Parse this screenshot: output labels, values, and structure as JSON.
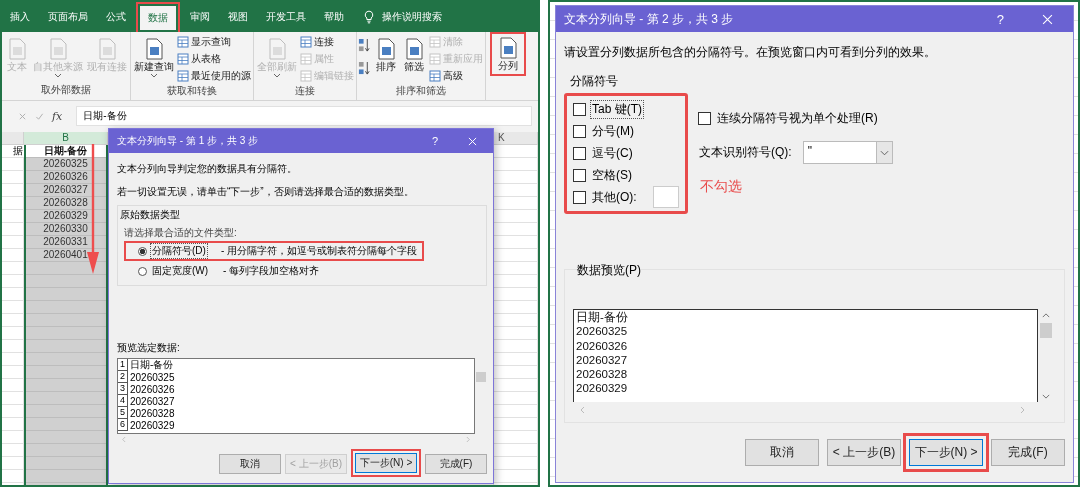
{
  "left": {
    "ribbon_tabs": [
      {
        "label": "插入",
        "selected": false,
        "highlighted": false
      },
      {
        "label": "页面布局",
        "selected": false,
        "highlighted": false
      },
      {
        "label": "公式",
        "selected": false,
        "highlighted": false
      },
      {
        "label": "数据",
        "selected": true,
        "highlighted": true
      },
      {
        "label": "审阅",
        "selected": false,
        "highlighted": false
      },
      {
        "label": "视图",
        "selected": false,
        "highlighted": false
      },
      {
        "label": "开发工具",
        "selected": false,
        "highlighted": false
      },
      {
        "label": "帮助",
        "selected": false,
        "highlighted": false
      }
    ],
    "tell_me": "操作说明搜索",
    "ribbon_groups": [
      {
        "label": "取外部数据",
        "commands": [
          {
            "kind": "large",
            "label": "文本",
            "disabled": true,
            "dropdown": false,
            "highlighted": false
          },
          {
            "kind": "large",
            "label": "自其他来源",
            "disabled": true,
            "dropdown": true,
            "highlighted": false
          },
          {
            "kind": "large",
            "label": "现有连接",
            "disabled": true,
            "dropdown": false,
            "highlighted": false
          }
        ]
      },
      {
        "label": "获取和转换",
        "commands": [
          {
            "kind": "large",
            "label": "新建查询",
            "disabled": false,
            "dropdown": true,
            "highlighted": false
          },
          {
            "kind": "small",
            "label": "显示查询",
            "disabled": false,
            "dropdown": false,
            "highlighted": false
          },
          {
            "kind": "small",
            "label": "从表格",
            "disabled": false,
            "dropdown": false,
            "highlighted": false
          },
          {
            "kind": "small",
            "label": "最近使用的源",
            "disabled": false,
            "dropdown": false,
            "highlighted": false
          }
        ]
      },
      {
        "label": "连接",
        "commands": [
          {
            "kind": "large",
            "label": "全部刷新",
            "disabled": true,
            "dropdown": true,
            "highlighted": false
          },
          {
            "kind": "small",
            "label": "连接",
            "disabled": false,
            "dropdown": false,
            "highlighted": false
          },
          {
            "kind": "small",
            "label": "属性",
            "disabled": true,
            "dropdown": false,
            "highlighted": false
          },
          {
            "kind": "small",
            "label": "编辑链接",
            "disabled": true,
            "dropdown": false,
            "highlighted": false
          }
        ]
      },
      {
        "label": "排序和筛选",
        "commands": [
          {
            "kind": "sort-pair"
          },
          {
            "kind": "large",
            "label": "排序",
            "disabled": false,
            "dropdown": false,
            "highlighted": false
          },
          {
            "kind": "large",
            "label": "筛选",
            "disabled": false,
            "dropdown": false,
            "highlighted": false
          },
          {
            "kind": "small",
            "label": "清除",
            "disabled": true,
            "dropdown": false,
            "highlighted": false
          },
          {
            "kind": "small",
            "label": "重新应用",
            "disabled": true,
            "dropdown": false,
            "highlighted": false
          },
          {
            "kind": "small",
            "label": "高级",
            "disabled": false,
            "dropdown": false,
            "highlighted": false
          }
        ]
      },
      {
        "commands": [
          {
            "kind": "large",
            "label": "分列",
            "disabled": false,
            "dropdown": false,
            "highlighted": true
          }
        ]
      }
    ],
    "formula_bar": {
      "function_label": "fx",
      "value": "日期-备份"
    },
    "sheet": {
      "column_headers": [
        {
          "label": "B",
          "selected": true
        },
        {
          "label": "K",
          "selected": false
        }
      ],
      "column_a": [
        "据"
      ],
      "column_b": [
        "日期-备份",
        "20260325",
        "20260326",
        "20260327",
        "20260328",
        "20260329",
        "20260330",
        "20260331",
        "20260401"
      ]
    },
    "dialog": {
      "title": "文本分列向导 - 第 1 步，共 3 步",
      "help_label": "?",
      "lines": [
        "文本分列向导判定您的数据具有分隔符。",
        "若一切设置无误，请单击“下一步”，否则请选择最合适的数据类型。"
      ],
      "group_label": "原始数据类型",
      "prompt": "请选择最合适的文件类型:",
      "options": [
        {
          "label": "分隔符号(D)",
          "hint": "- 用分隔字符，如逗号或制表符分隔每个字段",
          "selected": true,
          "highlighted": true
        },
        {
          "label": "固定宽度(W)",
          "hint": "- 每列字段加空格对齐",
          "selected": false,
          "highlighted": false
        }
      ],
      "preview_label": "预览选定数据:",
      "preview_rows": [
        {
          "number": "1",
          "text": "日期-备份"
        },
        {
          "number": "2",
          "text": "20260325"
        },
        {
          "number": "3",
          "text": "20260326"
        },
        {
          "number": "4",
          "text": "20260327"
        },
        {
          "number": "5",
          "text": "20260328"
        },
        {
          "number": "6",
          "text": "20260329"
        }
      ],
      "buttons": [
        {
          "label": "取消",
          "disabled": false,
          "default": false,
          "highlighted": false
        },
        {
          "label": "< 上一步(B)",
          "disabled": true,
          "default": false,
          "highlighted": false
        },
        {
          "label": "下一步(N) >",
          "disabled": false,
          "default": true,
          "highlighted": true
        },
        {
          "label": "完成(F)",
          "disabled": false,
          "default": false,
          "highlighted": false
        }
      ]
    }
  },
  "right": {
    "dialog": {
      "title": "文本分列向导 - 第 2 步，共 3 步",
      "help_label": "?",
      "intro": "请设置分列数据所包含的分隔符号。在预览窗口内可看到分列的效果。",
      "delimiter_label": "分隔符号",
      "delimiters_highlighted": true,
      "delimiters": [
        {
          "kind": "plain",
          "label": "Tab 键(T)",
          "checked": false
        },
        {
          "kind": "plain",
          "label": "分号(M)",
          "checked": false
        },
        {
          "kind": "plain",
          "label": "逗号(C)",
          "checked": false
        },
        {
          "kind": "plain",
          "label": "空格(S)",
          "checked": false
        },
        {
          "kind": "with-field",
          "label": "其他(O):",
          "checked": false
        }
      ],
      "consecutive": {
        "label": "连续分隔符号视为单个处理(R)",
        "checked": false
      },
      "qualifier": {
        "label": "文本识别符号(Q):",
        "value": "\""
      },
      "annotation": "不勾选",
      "preview_label": "数据预览(P)",
      "preview_rows": [
        "日期-备份",
        "20260325",
        "20260326",
        "20260327",
        "20260328",
        "20260329"
      ],
      "buttons": [
        {
          "label": "取消",
          "disabled": false,
          "default": false,
          "highlighted": false
        },
        {
          "label": "< 上一步(B)",
          "disabled": false,
          "default": false,
          "highlighted": false
        },
        {
          "label": "下一步(N) >",
          "disabled": false,
          "default": true,
          "highlighted": true
        },
        {
          "label": "完成(F)",
          "disabled": false,
          "default": false,
          "highlighted": false
        }
      ]
    }
  }
}
